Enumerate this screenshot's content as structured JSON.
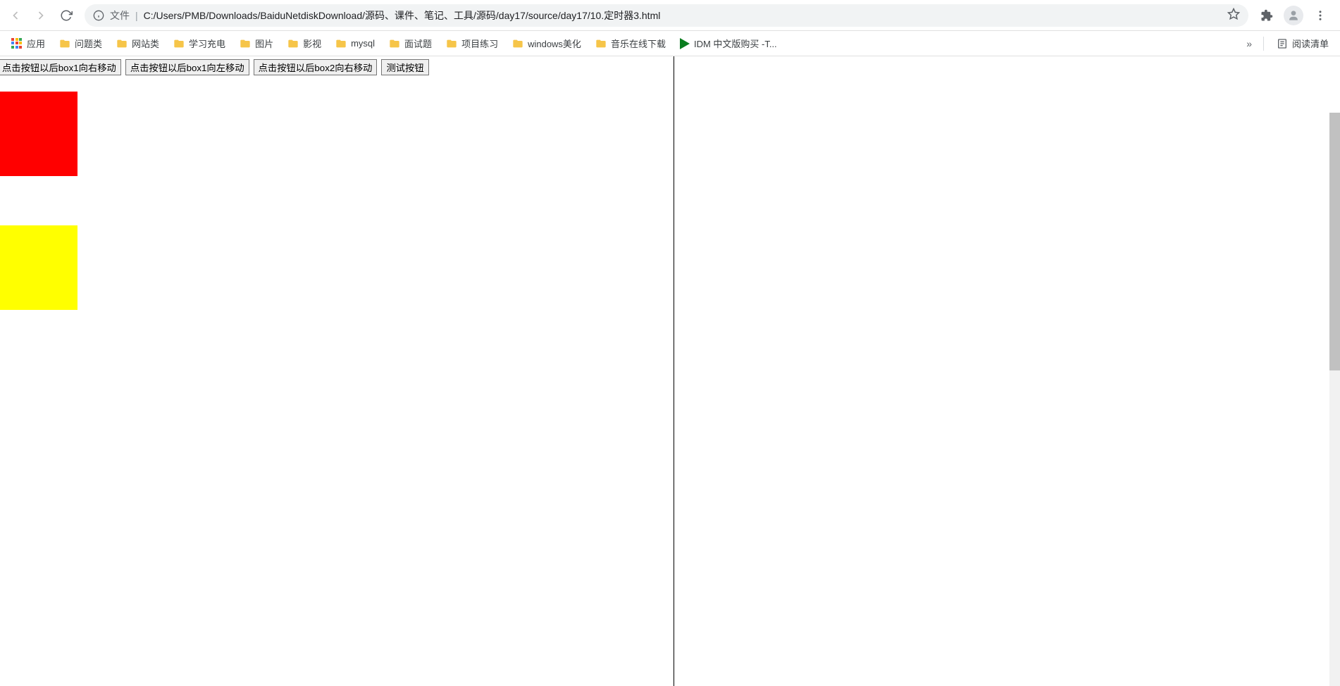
{
  "toolbar": {
    "file_label": "文件",
    "url": "C:/Users/PMB/Downloads/BaiduNetdiskDownload/源码、课件、笔记、工具/源码/day17/source/day17/10.定时器3.html"
  },
  "bookmarks": {
    "apps_label": "应用",
    "items": [
      {
        "label": "问题类"
      },
      {
        "label": "网站类"
      },
      {
        "label": "学习充电"
      },
      {
        "label": "图片"
      },
      {
        "label": "影视"
      },
      {
        "label": "mysql"
      },
      {
        "label": "面试题"
      },
      {
        "label": "项目练习"
      },
      {
        "label": "windows美化"
      },
      {
        "label": "音乐在线下载"
      }
    ],
    "idm_label": "IDM 中文版购买 -T...",
    "overflow": "»",
    "reading_list": "阅读清单"
  },
  "page": {
    "buttons": {
      "b1": "点击按钮以后box1向右移动",
      "b2": "点击按钮以后box1向左移动",
      "b3": "点击按钮以后box2向右移动",
      "b4": "测试按钮"
    }
  }
}
